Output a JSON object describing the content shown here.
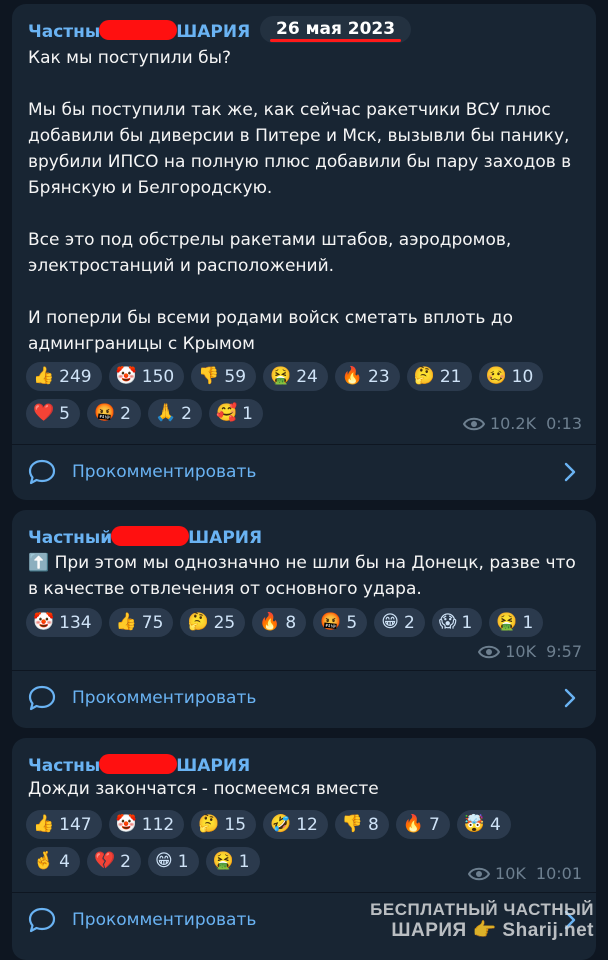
{
  "posts": [
    {
      "author_prefix": "Частны",
      "author_suffix": "ШАРИЯ",
      "date": "26 мая 2023",
      "paragraphs": [
        "Как мы поступили бы?",
        "Мы бы поступили так же, как сейчас ракетчики ВСУ плюс добавили бы диверсии в Питере и Мск, вызывли бы панику, врубили ИПСО на полную плюс добавили бы пару заходов в Брянскую и Белгородскую.",
        "Все это под обстрелы ракетами штабов, аэродромов, электростанций и расположений.",
        "И поперли бы всеми родами войск сметать вплоть до админграницы с Крымом"
      ],
      "reactions": [
        {
          "emoji": "👍",
          "count": "249"
        },
        {
          "emoji": "🤡",
          "count": "150"
        },
        {
          "emoji": "👎",
          "count": "59"
        },
        {
          "emoji": "🤮",
          "count": "24"
        },
        {
          "emoji": "🔥",
          "count": "23"
        },
        {
          "emoji": "🤔",
          "count": "21"
        },
        {
          "emoji": "🥴",
          "count": "10"
        },
        {
          "emoji": "❤️",
          "count": "5"
        },
        {
          "emoji": "🤬",
          "count": "2"
        },
        {
          "emoji": "🙏",
          "count": "2"
        },
        {
          "emoji": "🥰",
          "count": "1"
        }
      ],
      "views": "10.2K",
      "time": "0:13",
      "comment_label": "Прокомментировать"
    },
    {
      "author_prefix": "Частный",
      "author_suffix": "ШАРИЯ",
      "paragraphs": [
        "⬆️ При этом мы однозначно не шли бы на Донецк, разве что в качестве отвлечения от основного удара."
      ],
      "reactions": [
        {
          "emoji": "🤡",
          "count": "134"
        },
        {
          "emoji": "👍",
          "count": "75"
        },
        {
          "emoji": "🤔",
          "count": "25"
        },
        {
          "emoji": "🔥",
          "count": "8"
        },
        {
          "emoji": "🤬",
          "count": "5"
        },
        {
          "emoji": "😁",
          "count": "2"
        },
        {
          "emoji": "😱",
          "count": "1"
        },
        {
          "emoji": "🤮",
          "count": "1"
        }
      ],
      "views": "10K",
      "time": "9:57",
      "comment_label": "Прокомментировать"
    },
    {
      "author_prefix": "Частны",
      "author_suffix": "ШАРИЯ",
      "paragraphs": [
        "Дожди закончатся - посмеемся вместе"
      ],
      "reactions": [
        {
          "emoji": "👍",
          "count": "147"
        },
        {
          "emoji": "🤡",
          "count": "112"
        },
        {
          "emoji": "🤔",
          "count": "15"
        },
        {
          "emoji": "🤣",
          "count": "12"
        },
        {
          "emoji": "👎",
          "count": "8"
        },
        {
          "emoji": "🔥",
          "count": "7"
        },
        {
          "emoji": "🤯",
          "count": "4"
        },
        {
          "emoji": "🤞",
          "count": "4"
        },
        {
          "emoji": "💔",
          "count": "2"
        },
        {
          "emoji": "😁",
          "count": "1"
        },
        {
          "emoji": "🤮",
          "count": "1"
        }
      ],
      "views": "10K",
      "time": "10:01",
      "comment_label": "Прокомментировать"
    }
  ],
  "watermark": {
    "line1": "БЕСПЛАТНЫЙ ЧАСТНЫЙ",
    "line2": "ШАРИЯ 👉 Sharij.net"
  },
  "colors": {
    "background": "#0e1621",
    "card": "#182533",
    "accent": "#6ab3f3",
    "redaction": "#ff1010"
  }
}
